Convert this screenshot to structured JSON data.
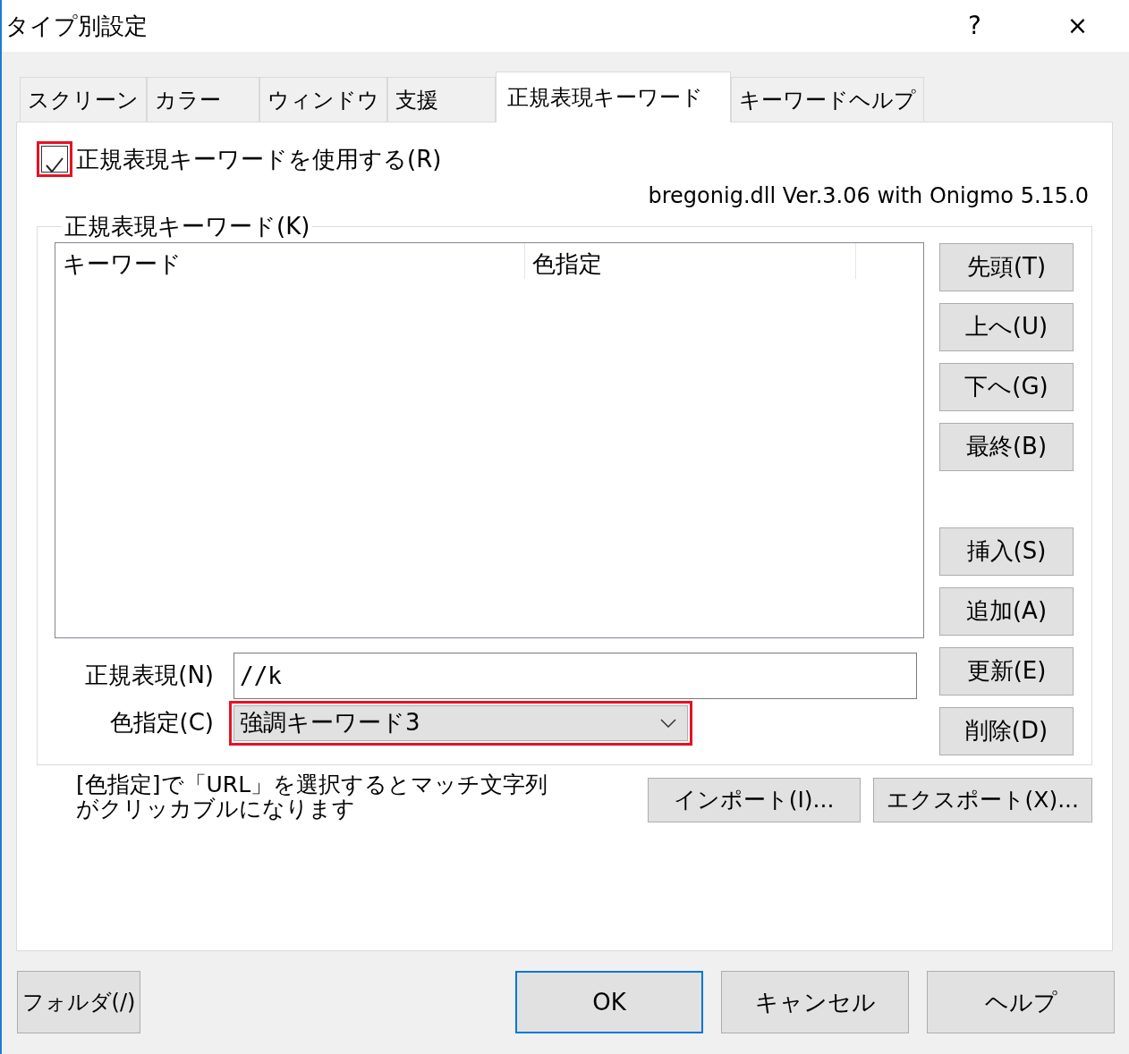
{
  "window": {
    "title": "タイプ別設定",
    "help_button": "?",
    "close_button": "×"
  },
  "tabs": [
    {
      "label": "スクリーン",
      "selected": false
    },
    {
      "label": "カラー",
      "selected": false
    },
    {
      "label": "ウィンドウ",
      "selected": false
    },
    {
      "label": "支援",
      "selected": false
    },
    {
      "label": "正規表現キーワード",
      "selected": true
    },
    {
      "label": "キーワードヘルプ",
      "selected": false
    }
  ],
  "use_regex": {
    "label": "正規表現キーワードを使用する(R)",
    "checked": true,
    "highlighted": true
  },
  "version": "bregonig.dll Ver.3.06 with Onigmo 5.15.0",
  "keyword_group": {
    "title": "正規表現キーワード(K)",
    "columns": [
      "キーワード",
      "色指定"
    ],
    "move_buttons": [
      "先頭(T)",
      "上へ(U)",
      "下へ(G)",
      "最終(B)"
    ],
    "edit_buttons": [
      "挿入(S)",
      "追加(A)",
      "更新(E)",
      "削除(D)"
    ],
    "regex": {
      "label": "正規表現(N)",
      "value": "//k"
    },
    "color": {
      "label": "色指定(C)",
      "value": "強調キーワード3",
      "highlighted": true
    }
  },
  "note": [
    "[色指定]で「URL」を選択するとマッチ文字列",
    "がクリッカブルになります"
  ],
  "io_buttons": [
    "インポート(I)...",
    "エクスポート(X)..."
  ],
  "footer_buttons": [
    {
      "label": "フォルダ(/)",
      "default": false
    },
    {
      "label": "OK",
      "default": true
    },
    {
      "label": "キャンセル",
      "default": false
    },
    {
      "label": "ヘルプ",
      "default": false
    }
  ]
}
